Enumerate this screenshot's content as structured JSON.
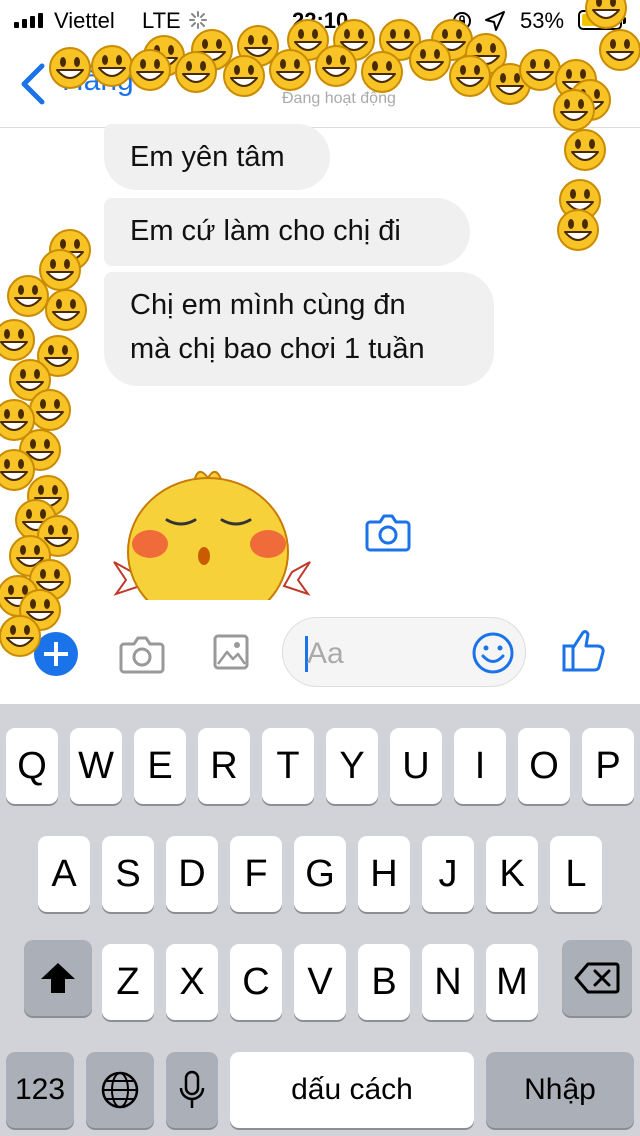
{
  "status_bar": {
    "carrier": "Viettel",
    "network": "LTE",
    "time": "22:10",
    "battery_percent": "53%",
    "battery_level": 0.53
  },
  "nav": {
    "contact_name": "Hằng",
    "contact_status": "Đang hoạt động"
  },
  "messages": [
    {
      "text": "Em yên tâm"
    },
    {
      "text": "Em cứ làm cho chị đi"
    },
    {
      "text_line1": "Chị em mình cùng đn",
      "text_line2": "mà chị bao chơi 1 tuần"
    }
  ],
  "composer": {
    "placeholder": "Aa"
  },
  "keyboard": {
    "row1": [
      "Q",
      "W",
      "E",
      "R",
      "T",
      "Y",
      "U",
      "I",
      "O",
      "P"
    ],
    "row2": [
      "A",
      "S",
      "D",
      "F",
      "G",
      "H",
      "J",
      "K",
      "L"
    ],
    "row3": [
      "Z",
      "X",
      "C",
      "V",
      "B",
      "N",
      "M"
    ],
    "numbers_key": "123",
    "space_key": "dấu cách",
    "return_key": "Nhập"
  },
  "icons": {
    "back": "chevron-left-icon",
    "camera": "camera-icon",
    "gallery": "image-icon",
    "emoji": "smiley-face-icon",
    "like": "thumbs-up-icon",
    "shift": "shift-arrow-icon",
    "delete": "backspace-icon",
    "globe": "globe-icon",
    "mic": "microphone-icon"
  },
  "colors": {
    "accent": "#1a73e8",
    "bubble": "#f1f0f0",
    "keyboard_bg": "#d1d3d9",
    "emoji_yellow": "#f8c325"
  }
}
